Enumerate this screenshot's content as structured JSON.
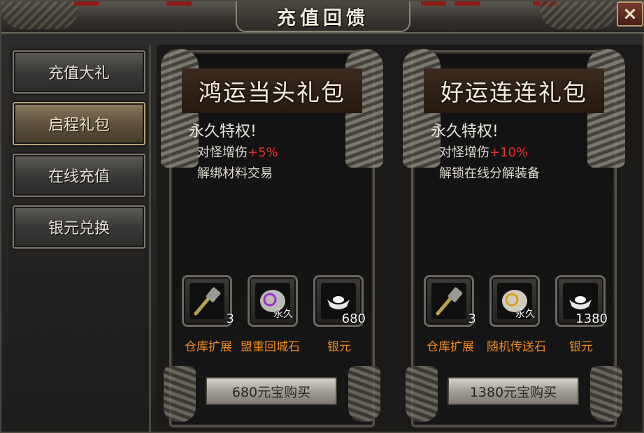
{
  "window": {
    "title": "充值回馈",
    "close_label": "×"
  },
  "sidebar": {
    "items": [
      {
        "label": "充值大礼",
        "active": false
      },
      {
        "label": "启程礼包",
        "active": true
      },
      {
        "label": "在线充值",
        "active": false
      },
      {
        "label": "银元兑换",
        "active": false
      }
    ]
  },
  "packs": [
    {
      "title": "鸿运当头礼包",
      "permanent": "永久特权!",
      "bonus_label": "对怪增伤",
      "bonus_value": "+5%",
      "perk": "解绑材料交易",
      "items": [
        {
          "name": "仓库扩展",
          "count": "3",
          "icon": "hammer-icon"
        },
        {
          "name": "盟重回城石",
          "tag": "永久",
          "icon": "scroll-stone-icon"
        },
        {
          "name": "银元",
          "count": "680",
          "icon": "silver-ingot-icon"
        }
      ],
      "buy_label": "680元宝购买"
    },
    {
      "title": "好运连连礼包",
      "permanent": "永久特权!",
      "bonus_label": "对怪增伤",
      "bonus_value": "+10%",
      "perk": "解锁在线分解装备",
      "items": [
        {
          "name": "仓库扩展",
          "count": "3",
          "icon": "hammer-icon"
        },
        {
          "name": "随机传送石",
          "tag": "永久",
          "icon": "scroll-stone-icon"
        },
        {
          "name": "银元",
          "count": "1380",
          "icon": "silver-ingot-icon"
        }
      ],
      "buy_label": "1380元宝购买"
    }
  ]
}
